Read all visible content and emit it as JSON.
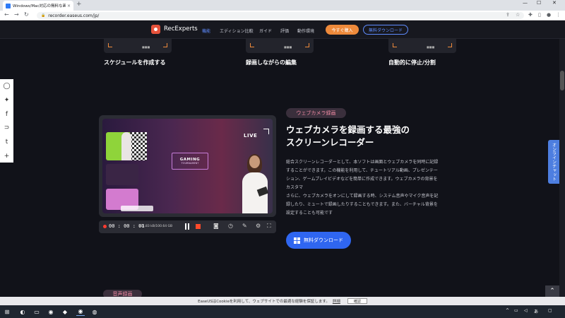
{
  "browser": {
    "tab_title": "Windows/Mac対応の無料な画面録...",
    "tab_close": "×",
    "new_tab": "+",
    "url": "recorder.easeus.com/jp/",
    "win_min": "—",
    "win_max": "☐",
    "win_close": "✕",
    "back": "←",
    "forward": "→",
    "reload": "↻"
  },
  "header": {
    "brand": "RecExperts",
    "nav": [
      "機能",
      "エディション比較",
      "ガイド",
      "評価",
      "動作環境"
    ],
    "buy_label": "今すぐ購入",
    "free_download_label": "無料ダウンロード"
  },
  "features_top": [
    {
      "label": "スケジュールを作成する"
    },
    {
      "label": "録画しながらの編集"
    },
    {
      "label": "自動的に停止/分割"
    }
  ],
  "share_icons": [
    "line-icon",
    "twitter-icon",
    "facebook-icon",
    "pocket-icon",
    "tumblr-icon",
    "plus-icon"
  ],
  "share_glyphs": [
    "◯",
    "✦",
    "f",
    "⊃",
    "t",
    "+"
  ],
  "chat_tab": "オンラインチャット",
  "panel": {
    "live_label": "LIVE",
    "gaming_title": "GAMING",
    "gaming_subtitle": "TOURNAMENT",
    "timer": "00 : 00 : 01",
    "size": "184.83 kB/100.64 GB"
  },
  "section": {
    "tag": "ウェブカメラ録画",
    "heading_line1": "ウェブカメラを録画する最強の",
    "heading_line2": "スクリーンレコーダー",
    "para1_lines": [
      "総合スクリーンレコーダーとして、本ソフトは画面とウェブカメラを同時に記録",
      "することができます。この機能を利用して、チュートリアル動画、プレゼンテー",
      "ション、ゲームプレイビデオなどを簡単に作成できます。ウェブカメラの背景を",
      "カスタマ"
    ],
    "para2_lines": [
      "さらに、ウェブカメラをオンにして録画する時、システム音声やマイク音声を記",
      "録したり、ミュートで録画したりすることもできます。また、バーチャル背景を",
      "設定することも可能です"
    ],
    "download_label": "無料ダウンロード"
  },
  "next_section_tag": "音声録画",
  "cookie": {
    "text": "EaseUSはCookieを利用して、ウェブサイトでの最適な経験を保証します。",
    "link": "詳細",
    "button": "確認"
  },
  "taskbar": {
    "ime": "あ"
  }
}
